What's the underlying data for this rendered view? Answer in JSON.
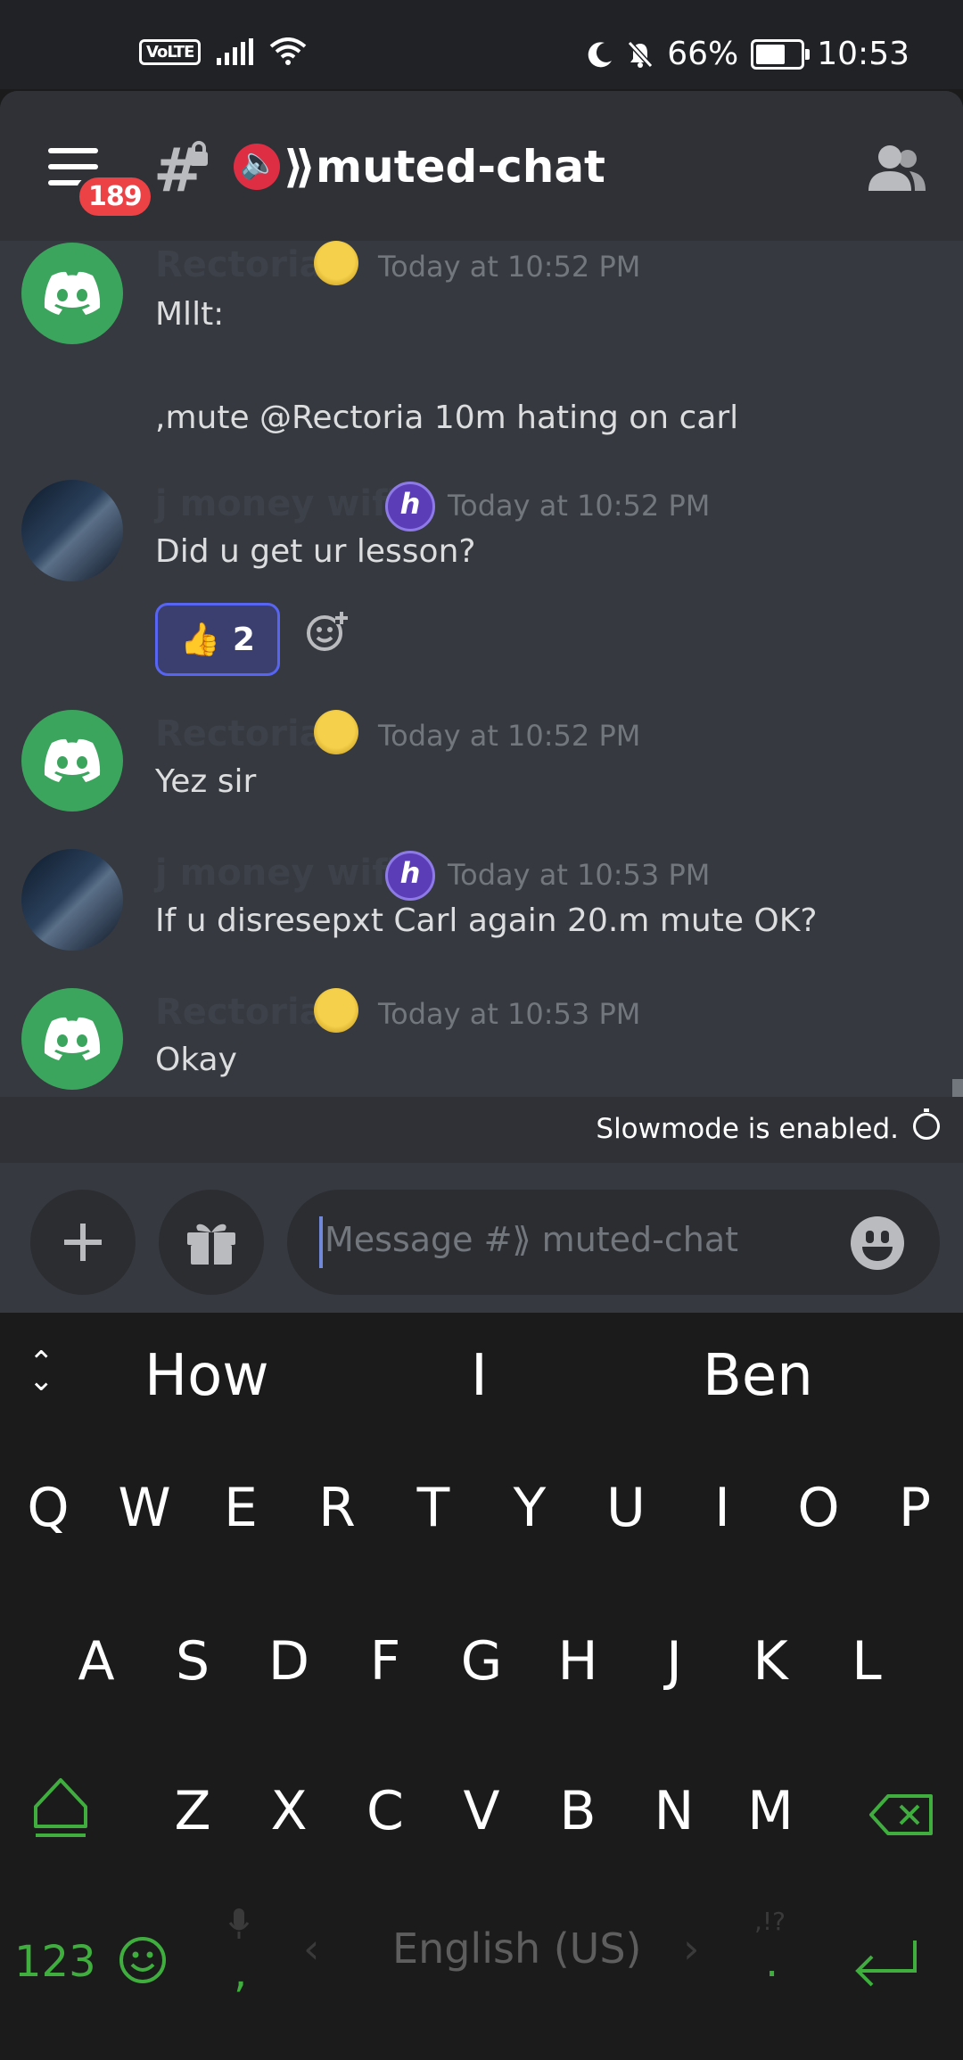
{
  "status_bar": {
    "volte": "VoLTE",
    "battery": "66%",
    "time": "10:53",
    "battery_level": 0.66
  },
  "header": {
    "notification_count": "189",
    "channel_name": "⟫muted-chat",
    "channel_prefix_icon": "muted-speaker-icon"
  },
  "messages": [
    {
      "author": "Rectoria",
      "badge": "laughing-emoji-icon",
      "time": "Today at 10:52 PM",
      "text": "Mllt:\n\n,mute @Rectoria 10m hating on carl"
    },
    {
      "author": "j money wifi",
      "badge": "h",
      "time": "Today at 10:52 PM",
      "text": "Did u get ur lesson?",
      "reaction": {
        "emoji": "👍",
        "count": "2"
      }
    },
    {
      "author": "Rectoria",
      "badge": "laughing-emoji-icon",
      "time": "Today at 10:52 PM",
      "text": "Yez sir"
    },
    {
      "author": "j money wifi",
      "badge": "h",
      "time": "Today at 10:53 PM",
      "text": "If u disresepxt Carl again 20.m mute OK?"
    },
    {
      "author": "Rectoria",
      "badge": "laughing-emoji-icon",
      "time": "Today at 10:53 PM",
      "text": "Okay"
    }
  ],
  "slowmode": {
    "text": "Slowmode is enabled."
  },
  "composer": {
    "placeholder": "Message #⟫ muted-chat"
  },
  "keyboard": {
    "suggestions": [
      "How",
      "I",
      "Ben"
    ],
    "row1": [
      "Q",
      "W",
      "E",
      "R",
      "T",
      "Y",
      "U",
      "I",
      "O",
      "P"
    ],
    "row2": [
      "A",
      "S",
      "D",
      "F",
      "G",
      "H",
      "J",
      "K",
      "L"
    ],
    "row3": [
      "Z",
      "X",
      "C",
      "V",
      "B",
      "N",
      "M"
    ],
    "numbers_key": "123",
    "comma_key": ",",
    "language": "English (US)",
    "punct_hint": ",!?",
    "period_key": "."
  },
  "colors": {
    "accent": "#5865f2",
    "discord_green": "#3ba55d",
    "badge_red": "#ed4245",
    "keyboard_green": "#3fae3f"
  }
}
